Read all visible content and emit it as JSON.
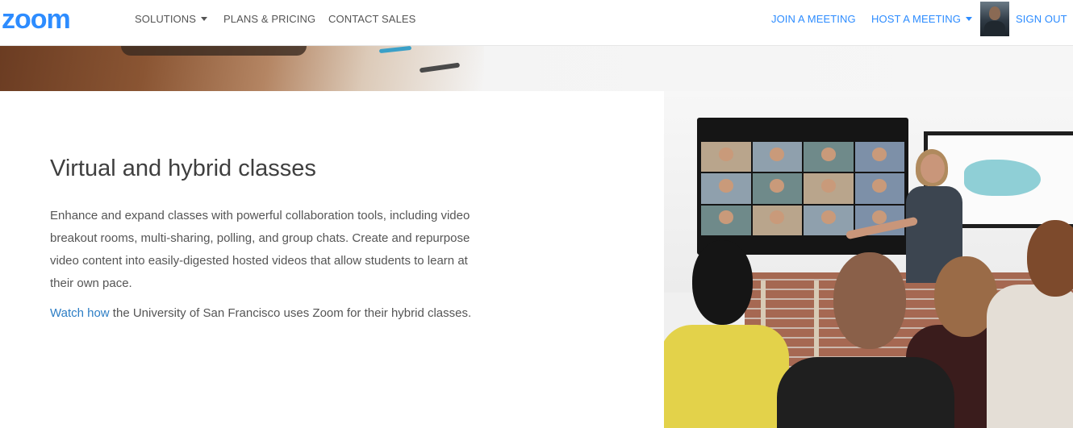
{
  "colors": {
    "brand": "#2d8cff",
    "link": "#2d7ec5",
    "text": "#555555",
    "title": "#3f3f3f"
  },
  "nav": {
    "logo": "zoom",
    "solutions": "SOLUTIONS",
    "plans_pricing": "PLANS & PRICING",
    "contact_sales": "CONTACT SALES",
    "join_meeting": "JOIN A MEETING",
    "host_meeting": "HOST A MEETING",
    "sign_out": "SIGN OUT"
  },
  "section": {
    "title": "Virtual and hybrid classes",
    "description": "Enhance and expand classes with powerful collaboration tools, including video breakout rooms, multi-sharing, polling, and group chats. Create and repurpose video content into easily-digested hosted videos that allow students to learn at their own pace.",
    "watch_link": "Watch how",
    "watch_rest": " the University of San Francisco uses Zoom for their hybrid classes."
  }
}
